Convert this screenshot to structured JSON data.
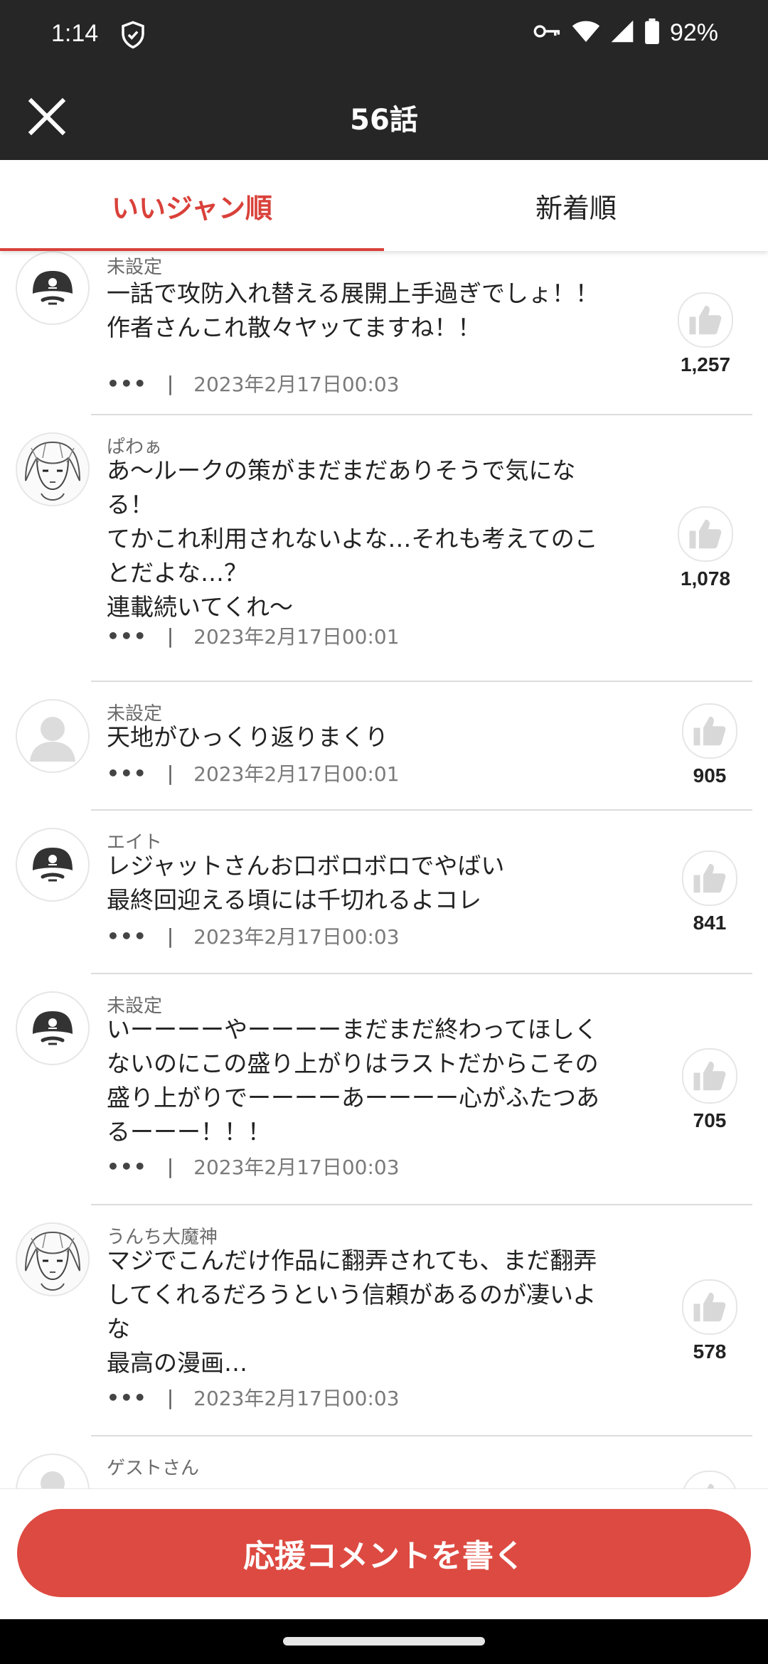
{
  "status_bar": {
    "time": "1:14",
    "battery": "92%"
  },
  "app_bar": {
    "title": "56話"
  },
  "tabs": [
    {
      "label": "いいジャン順",
      "active": true
    },
    {
      "label": "新着順",
      "active": false
    }
  ],
  "colors": {
    "accent": "#d9413a",
    "bar": "#262626"
  },
  "comments": [
    {
      "user": "未設定",
      "avatar": "pirate",
      "text": "一話で攻防入れ替える展開上手過ぎでしょ！！\n作者さんこれ散々ヤッてますね！！",
      "more": "•••",
      "sep": "|",
      "date": "2023年2月17日00:03",
      "likes": "1,257"
    },
    {
      "user": "ぱわぁ",
      "avatar": "manga",
      "text": "あ〜ルークの策がまだまだありそうで気にな\nる！\nてかこれ利用されないよな…それも考えてのこ\nとだよな…？\n連載続いてくれ〜",
      "more": "•••",
      "sep": "|",
      "date": "2023年2月17日00:01",
      "likes": "1,078"
    },
    {
      "user": "未設定",
      "avatar": "default",
      "text": "天地がひっくり返りまくり",
      "more": "•••",
      "sep": "|",
      "date": "2023年2月17日00:01",
      "likes": "905"
    },
    {
      "user": "エイト",
      "avatar": "pirate",
      "text": "レジャットさんお口ボロボロでやばい\n最終回迎える頃には千切れるよコレ",
      "more": "•••",
      "sep": "|",
      "date": "2023年2月17日00:03",
      "likes": "841"
    },
    {
      "user": "未設定",
      "avatar": "pirate",
      "text": "いーーーーやーーーーまだまだ終わってほしく\nないのにこの盛り上がりはラストだからこその\n盛り上がりでーーーーあーーーー心がふたつあ\nるーーー！！！",
      "more": "•••",
      "sep": "|",
      "date": "2023年2月17日00:03",
      "likes": "705"
    },
    {
      "user": "うんち大魔神",
      "avatar": "manga",
      "text": "マジでこんだけ作品に翻弄されても、まだ翻弄\nしてくれるだろうという信頼があるのが凄いよ\nな\n最高の漫画…",
      "more": "•••",
      "sep": "|",
      "date": "2023年2月17日00:03",
      "likes": "578"
    },
    {
      "user": "ゲストさん",
      "avatar": "default"
    }
  ],
  "cta": {
    "label": "応援コメントを書く"
  },
  "icons": {
    "close": "close-icon",
    "like": "thumbs-up-icon",
    "shield": "shield-check-icon",
    "key": "key-icon",
    "wifi": "wifi-icon",
    "signal": "signal-icon",
    "battery": "battery-icon"
  }
}
